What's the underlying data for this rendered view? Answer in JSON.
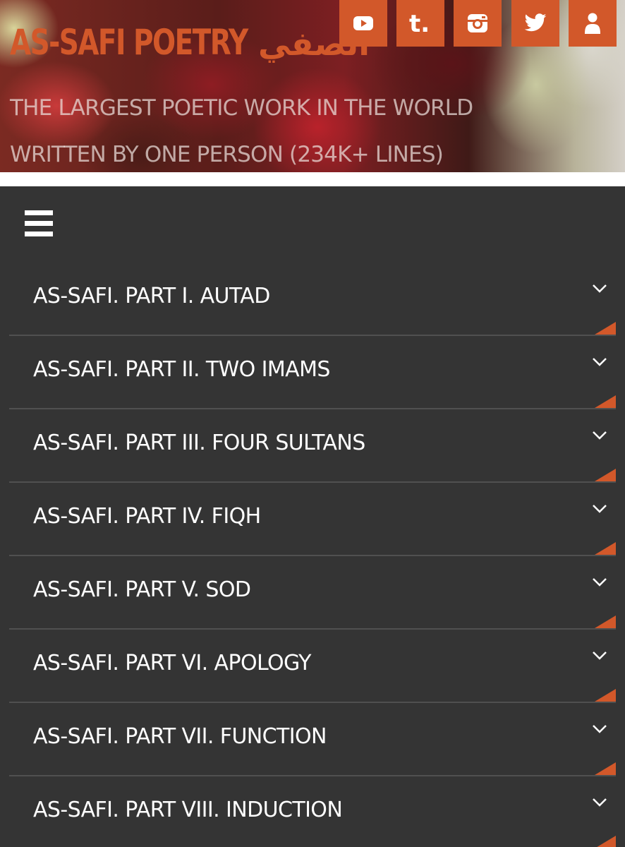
{
  "header": {
    "brand": "AS-SAFI POETRY",
    "brand_arabic": "الصفي",
    "tagline": "THE LARGEST POETIC WORK IN THE WORLD WRITTEN BY ONE PERSON (234K+ LINES)",
    "social": [
      {
        "icon": "youtube-icon"
      },
      {
        "icon": "tumblr-icon"
      },
      {
        "icon": "instagram-icon"
      },
      {
        "icon": "twitter-icon"
      },
      {
        "icon": "user-icon"
      }
    ],
    "accent_color": "#d2582a"
  },
  "nav": {
    "menu_icon": "hamburger-menu-icon",
    "background": "#343434",
    "items": [
      {
        "label": "AS-SAFI. PART I. AUTAD"
      },
      {
        "label": "AS-SAFI. PART II. TWO IMAMS"
      },
      {
        "label": "AS-SAFI. PART III. FOUR SULTANS"
      },
      {
        "label": "AS-SAFI. PART IV. FIQH"
      },
      {
        "label": "AS-SAFI. PART V. SOD"
      },
      {
        "label": "AS-SAFI. PART VI. APOLOGY"
      },
      {
        "label": "AS-SAFI. PART VII. FUNCTION"
      },
      {
        "label": "AS-SAFI. PART VIII. INDUCTION"
      }
    ]
  }
}
